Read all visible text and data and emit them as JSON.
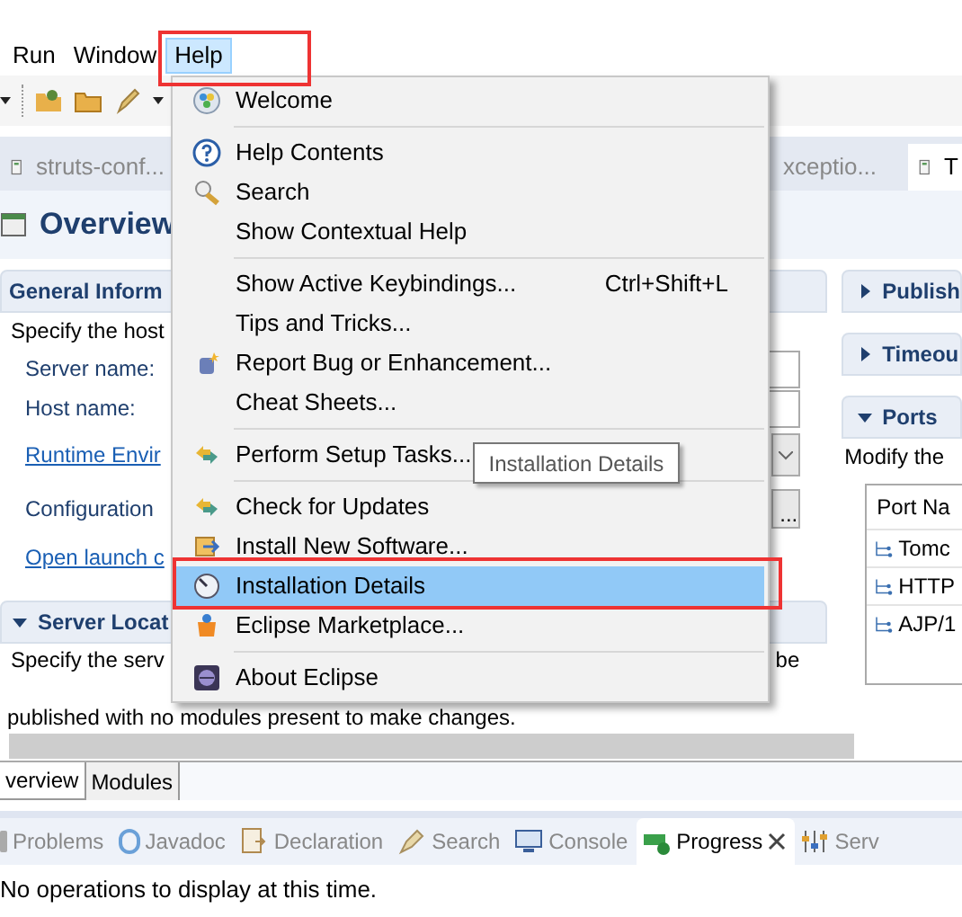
{
  "menu_bar": [
    {
      "label": "Run",
      "selected": false
    },
    {
      "label": "Window",
      "selected": false
    },
    {
      "label": "Help",
      "selected": true
    }
  ],
  "editor_tabs": [
    {
      "label": "struts-conf...",
      "selected": false
    },
    {
      "label": "xceptio...",
      "selected": false
    },
    {
      "label": "T",
      "selected": true
    }
  ],
  "editor": {
    "title": "Overview",
    "general": {
      "title": "General Inform",
      "description": "Specify the host",
      "rows": [
        {
          "kind": "input",
          "label": "Server name:"
        },
        {
          "kind": "input",
          "label": "Host name:"
        },
        {
          "kind": "select",
          "label": "Runtime Envir"
        },
        {
          "kind": "browse",
          "label": "Configuration",
          "button": "..."
        },
        {
          "kind": "link",
          "label": "Open launch c"
        }
      ]
    },
    "server_locations": {
      "title": "Server Locat",
      "expanded": true,
      "description": "Specify the serv",
      "description_end": "be",
      "note": "published with no modules present to make changes."
    },
    "sections": [
      {
        "title": "Publish",
        "expanded": false
      },
      {
        "title": "Timeou",
        "expanded": false
      },
      {
        "title": "Ports",
        "expanded": true
      }
    ],
    "ports": {
      "description": "Modify the",
      "column": "Port Na",
      "rows": [
        "Tomc",
        "HTTP",
        "AJP/1"
      ]
    },
    "bottom_tabs": [
      {
        "label": "verview",
        "selected": true
      },
      {
        "label": "Modules",
        "selected": false
      }
    ]
  },
  "views": [
    {
      "label": "Problems",
      "selected": false
    },
    {
      "label": "Javadoc",
      "selected": false
    },
    {
      "label": "Declaration",
      "selected": false
    },
    {
      "label": "Search",
      "selected": false
    },
    {
      "label": "Console",
      "selected": false
    },
    {
      "label": "Progress",
      "selected": true
    },
    {
      "label": "Serv",
      "selected": false
    }
  ],
  "status": "No operations to display at this time.",
  "help_menu": [
    {
      "kind": "item",
      "label": "Welcome",
      "selected": false
    },
    {
      "kind": "separator"
    },
    {
      "kind": "item",
      "label": "Help Contents",
      "selected": false
    },
    {
      "kind": "item",
      "label": "Search",
      "selected": false
    },
    {
      "kind": "item",
      "label": "Show Contextual Help",
      "selected": false
    },
    {
      "kind": "separator"
    },
    {
      "kind": "item",
      "label": "Show Active Keybindings...",
      "shortcut": "Ctrl+Shift+L",
      "selected": false
    },
    {
      "kind": "item",
      "label": "Tips and Tricks...",
      "selected": false
    },
    {
      "kind": "item",
      "label": "Report Bug or Enhancement...",
      "selected": false
    },
    {
      "kind": "item",
      "label": "Cheat Sheets...",
      "selected": false
    },
    {
      "kind": "separator"
    },
    {
      "kind": "item",
      "label": "Perform Setup Tasks...",
      "selected": false
    },
    {
      "kind": "separator"
    },
    {
      "kind": "item",
      "label": "Check for Updates",
      "selected": false
    },
    {
      "kind": "item",
      "label": "Install New Software...",
      "selected": false
    },
    {
      "kind": "item",
      "label": "Installation Details",
      "selected": true
    },
    {
      "kind": "item",
      "label": "Eclipse Marketplace...",
      "selected": false
    },
    {
      "kind": "separator"
    },
    {
      "kind": "item",
      "label": "About Eclipse",
      "selected": false
    }
  ],
  "tooltip": "Installation Details"
}
